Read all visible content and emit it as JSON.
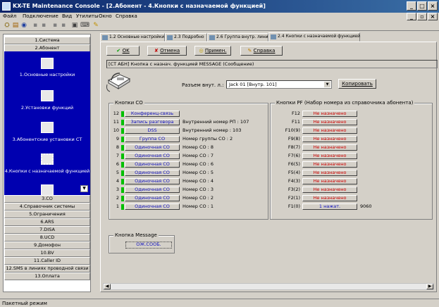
{
  "window": {
    "title": "KX-TE Maintenance Console - [2.Абонент - 4.Кнопки с назначаемой функцией]"
  },
  "menu": [
    "Файл",
    "Подключение",
    "Вид",
    "Утилиты",
    "Окно",
    "Справка"
  ],
  "nav": {
    "top": [
      "1.Система",
      "2.Абонент"
    ],
    "sub": [
      "1.Основные настройки",
      "2.Установки функций",
      "3.Абонентские установки СТ",
      "4.Кнопки с назначаемой функцией"
    ],
    "bottom": [
      "3.CO",
      "4.Справочник системы",
      "5.Ограничения",
      "6.ARS",
      "7.DISA",
      "8.UCD",
      "9.Домофон",
      "10.BV",
      "11.Caller ID",
      "12.SMS в линиях проводной связи",
      "13.Оплата"
    ]
  },
  "tabs": [
    "1.2 Основные настройки",
    "2.3 Подробно",
    "2.6 Группа внутр. линий",
    "2.4 Кнопки с назначаемой функцией"
  ],
  "toolbar": {
    "ok": "OK",
    "cancel": "Отмена",
    "apply": "Примен.",
    "help": "Справка"
  },
  "header_text": "[СТ АБН] Кнопка с назнач. функцией MESSAGE (Сообщение)",
  "ext": {
    "label": "Разъем внут. л.:",
    "value": "Jack 01 [Внутр. 101]",
    "copy": "Копировать"
  },
  "co_group": {
    "title": "Кнопки CO",
    "rows": [
      {
        "n": "12",
        "key": "Конференц-связь",
        "info": ""
      },
      {
        "n": "11",
        "key": "Запись разговора",
        "info": "Внутренний номер РП : 107"
      },
      {
        "n": "10",
        "key": "DSS",
        "info": "Внутренний номер : 103"
      },
      {
        "n": "9",
        "key": "Группа CO",
        "info": "Номер группы CO : 2"
      },
      {
        "n": "8",
        "key": "Одиночная CO",
        "info": "Номер CO : 8"
      },
      {
        "n": "7",
        "key": "Одиночная CO",
        "info": "Номер CO : 7"
      },
      {
        "n": "6",
        "key": "Одиночная CO",
        "info": "Номер CO : 6"
      },
      {
        "n": "5",
        "key": "Одиночная CO",
        "info": "Номер CO : 5"
      },
      {
        "n": "4",
        "key": "Одиночная CO",
        "info": "Номер CO : 4"
      },
      {
        "n": "3",
        "key": "Одиночная CO",
        "info": "Номер CO : 3"
      },
      {
        "n": "2",
        "key": "Одиночная CO",
        "info": "Номер CO : 2"
      },
      {
        "n": "1",
        "key": "Одиночная CO",
        "info": "Номер CO : 1"
      }
    ]
  },
  "pf_group": {
    "title": "Кнопки PF (Набор номера из справочника абонента)",
    "rows": [
      {
        "n": "F12",
        "key": "Не назначено",
        "info": ""
      },
      {
        "n": "F11",
        "key": "Не назначено",
        "info": ""
      },
      {
        "n": "F10(9)",
        "key": "Не назначено",
        "info": ""
      },
      {
        "n": "F9(8)",
        "key": "Не назначено",
        "info": ""
      },
      {
        "n": "F8(7)",
        "key": "Не назначено",
        "info": ""
      },
      {
        "n": "F7(6)",
        "key": "Не назначено",
        "info": ""
      },
      {
        "n": "F6(5)",
        "key": "Не назначено",
        "info": ""
      },
      {
        "n": "F5(4)",
        "key": "Не назначено",
        "info": ""
      },
      {
        "n": "F4(3)",
        "key": "Не назначено",
        "info": ""
      },
      {
        "n": "F3(2)",
        "key": "Не назначено",
        "info": ""
      },
      {
        "n": "F2(1)",
        "key": "Не назначено",
        "info": ""
      },
      {
        "n": "F1(0)",
        "key": "1 нажат.",
        "info": "9060"
      }
    ]
  },
  "message_group": {
    "title": "Кнопка Message",
    "button": "ОЖ.СООБ."
  },
  "status": "Пакетный режим",
  "colors": {
    "title_blue": "#0a246a",
    "nav_blue": "#0000b0",
    "led_green": "#00c000",
    "unassigned_red": "#d00000",
    "key_blue": "#1010c0"
  }
}
